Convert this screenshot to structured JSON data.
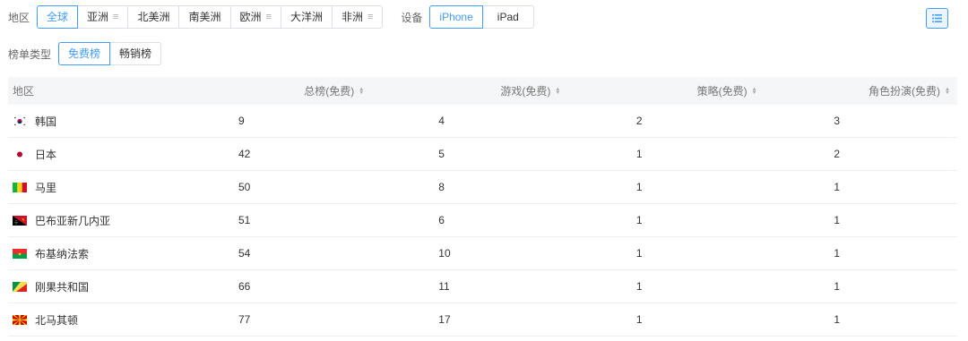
{
  "filters": {
    "region_label": "地区",
    "regions": [
      {
        "label": "全球",
        "active": true,
        "menu": false
      },
      {
        "label": "亚洲",
        "active": false,
        "menu": true
      },
      {
        "label": "北美洲",
        "active": false,
        "menu": false
      },
      {
        "label": "南美洲",
        "active": false,
        "menu": false
      },
      {
        "label": "欧洲",
        "active": false,
        "menu": true
      },
      {
        "label": "大洋洲",
        "active": false,
        "menu": false
      },
      {
        "label": "非洲",
        "active": false,
        "menu": true
      }
    ],
    "device_label": "设备",
    "devices": [
      {
        "label": "iPhone",
        "active": true
      },
      {
        "label": "iPad",
        "active": false
      }
    ],
    "chart_type_label": "榜单类型",
    "chart_types": [
      {
        "label": "免费榜",
        "active": true
      },
      {
        "label": "畅销榜",
        "active": false
      }
    ],
    "menu_glyph": "≡"
  },
  "table": {
    "headers": [
      "地区",
      "总榜(免费)",
      "游戏(免费)",
      "策略(免费)",
      "角色扮演(免费)"
    ],
    "sort_up": "▲",
    "sort_down": "▼",
    "rows": [
      {
        "country": "韩国",
        "flag": "flag-kr-icon",
        "values": [
          "9",
          "4",
          "2",
          "3"
        ]
      },
      {
        "country": "日本",
        "flag": "flag-jp-icon",
        "values": [
          "42",
          "5",
          "1",
          "2"
        ]
      },
      {
        "country": "马里",
        "flag": "flag-ml-icon",
        "values": [
          "50",
          "8",
          "1",
          "1"
        ]
      },
      {
        "country": "巴布亚新几内亚",
        "flag": "flag-pg-icon",
        "values": [
          "51",
          "6",
          "1",
          "1"
        ]
      },
      {
        "country": "布基纳法索",
        "flag": "flag-bf-icon",
        "values": [
          "54",
          "10",
          "1",
          "1"
        ]
      },
      {
        "country": "刚果共和国",
        "flag": "flag-cg-icon",
        "values": [
          "66",
          "11",
          "1",
          "1"
        ]
      },
      {
        "country": "北马其顿",
        "flag": "flag-mk-icon",
        "values": [
          "77",
          "17",
          "1",
          "1"
        ]
      }
    ]
  },
  "colors": {
    "accent": "#409eff"
  }
}
